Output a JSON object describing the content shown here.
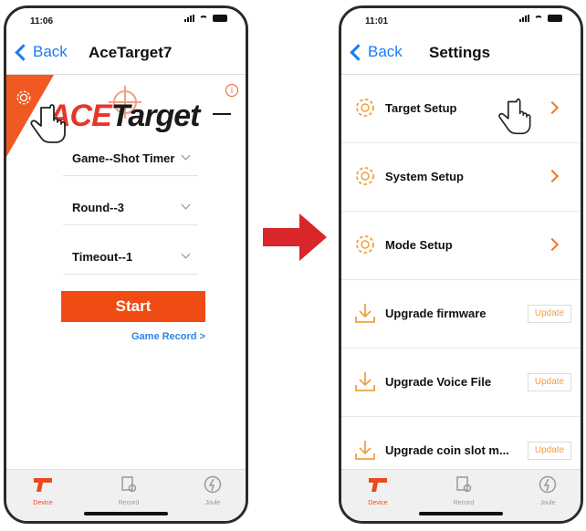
{
  "left_screen": {
    "status_time": "11:06",
    "back_label": "Back",
    "title": "AceTarget7",
    "logo_prefix": "ACE",
    "logo_rest": "Target",
    "options": [
      "Game--Shot Timer",
      "Round--3",
      "Timeout--1"
    ],
    "start_label": "Start",
    "game_record_link": "Game Record >",
    "info_label": "i",
    "tabs": [
      {
        "label": "Device",
        "icon": "pistol-icon",
        "active": true
      },
      {
        "label": "Record",
        "icon": "record-icon",
        "active": false
      },
      {
        "label": "Joule",
        "icon": "joule-icon",
        "active": false
      }
    ]
  },
  "right_screen": {
    "status_time": "11:01",
    "back_label": "Back",
    "title": "Settings",
    "rows": [
      {
        "label": "Target Setup",
        "icon": "gear-icon",
        "action": "chevron"
      },
      {
        "label": "System Setup",
        "icon": "gear-icon",
        "action": "chevron"
      },
      {
        "label": "Mode Setup",
        "icon": "gear-icon",
        "action": "chevron"
      },
      {
        "label": "Upgrade firmware",
        "icon": "download-icon",
        "action": "Update"
      },
      {
        "label": "Upgrade Voice File",
        "icon": "download-icon",
        "action": "Update"
      },
      {
        "label": "Upgrade coin slot m...",
        "icon": "download-icon",
        "action": "Update"
      }
    ],
    "tabs": [
      {
        "label": "Device",
        "icon": "pistol-icon",
        "active": true
      },
      {
        "label": "Record",
        "icon": "record-icon",
        "active": false
      },
      {
        "label": "Joule",
        "icon": "joule-icon",
        "active": false
      }
    ]
  },
  "colors": {
    "accent_orange": "#f04b12",
    "link_blue": "#1a7cf0",
    "arrow_red": "#d8262b"
  }
}
